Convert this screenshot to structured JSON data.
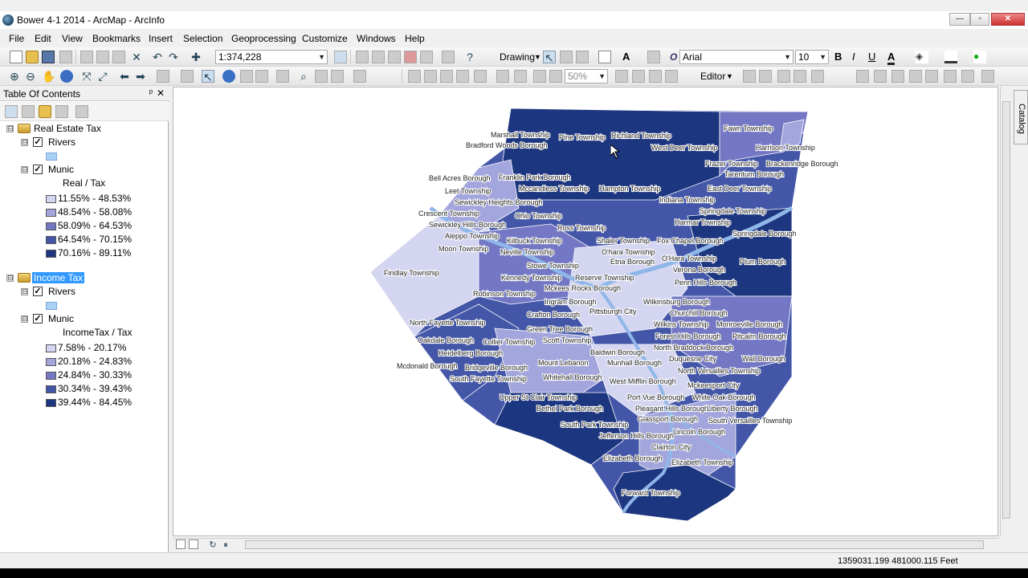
{
  "window": {
    "title": "Bower 4-1 2014 - ArcMap - ArcInfo",
    "min_glyph": "—",
    "max_glyph": "▫",
    "close_glyph": "✕"
  },
  "menu": [
    "File",
    "Edit",
    "View",
    "Bookmarks",
    "Insert",
    "Selection",
    "Geoprocessing",
    "Customize",
    "Windows",
    "Help"
  ],
  "toolbar": {
    "scale_value": "1:374,228",
    "drawing_label": "Drawing",
    "font_name": "Arial",
    "font_size": "10",
    "bold": "B",
    "italic": "I",
    "underline": "U",
    "text_tool": "A",
    "zoom_percent": "50%",
    "editor_label": "Editor"
  },
  "toc": {
    "title": "Table Of Contents",
    "pin_glyph": "ᵖ",
    "close_glyph": "✕",
    "expander_glyph": "⊟",
    "check_glyph": "✓",
    "groups": [
      {
        "name": "Real Estate Tax",
        "rivers_label": "Rivers",
        "munic_label": "Munic",
        "field_label": "Real / Tax",
        "classes": [
          {
            "label": "11.55% - 48.53%",
            "color": "#d4d5f0"
          },
          {
            "label": "48.54% - 58.08%",
            "color": "#a3a6dc"
          },
          {
            "label": "58.09% - 64.53%",
            "color": "#7478c4"
          },
          {
            "label": "64.54% - 70.15%",
            "color": "#4356a8"
          },
          {
            "label": "70.16% - 89.11%",
            "color": "#1d3680"
          }
        ]
      },
      {
        "name": "Income Tax",
        "rivers_label": "Rivers",
        "munic_label": "Munic",
        "field_label": "IncomeTax / Tax",
        "classes": [
          {
            "label": "7.58% - 20.17%",
            "color": "#d4d5f0"
          },
          {
            "label": "20.18% - 24.83%",
            "color": "#a3a6dc"
          },
          {
            "label": "24.84% - 30.33%",
            "color": "#7478c4"
          },
          {
            "label": "30.34% - 39.43%",
            "color": "#4356a8"
          },
          {
            "label": "39.44% - 84.45%",
            "color": "#1d3680"
          }
        ]
      }
    ]
  },
  "map": {
    "river_color": "#8fb6e8",
    "labels": [
      "Marshall Township",
      "Pine Township",
      "Richland Township",
      "Fawn Township",
      "Bradford Woods Borough",
      "West Deer Township",
      "Harrison Township",
      "Frazer Township",
      "Brackenridge Borough",
      "Tarentum Borough",
      "Bell Acres Borough",
      "Franklin Park Borough",
      "Leet Township",
      "Mccandless Township",
      "Hampton Township",
      "East Deer Township",
      "Sewickley Heights Borough",
      "Indiana Township",
      "Springdale Township",
      "Crescent Township",
      "Ohio Township",
      "Harmar Township",
      "Sewickley Hills Borough",
      "Ross Township",
      "Springdale Borough",
      "Aleppo Township",
      "Kilbuck Township",
      "Shaler Township",
      "Fox Chapel Borough",
      "Moon Township",
      "Neville Township",
      "O'hara Township",
      "O'Hara Township",
      "Plum Borough",
      "Etna Borough",
      "Verona Borough",
      "Stowe Township",
      "Findlay Township",
      "Kennedy Township",
      "Reserve Township",
      "Penn Hills Borough",
      "Mckees Rocks Borough",
      "Robinson Township",
      "Ingram Borough",
      "Wilkinsburg Borough",
      "Pittsburgh City",
      "Crafton Borough",
      "Churchill Borough",
      "North Fayette Township",
      "Wilkins Township",
      "Monroeville Borough",
      "Green Tree Borough",
      "Forest Hills Borough",
      "Pitcairn Borough",
      "Oakdale Borough",
      "Collier Township",
      "Scott Township",
      "North Braddock Borough",
      "Heidelberg Borough",
      "Baldwin Borough",
      "Duquesne City",
      "Wall Borough",
      "Mount Lebanon",
      "Munhall Borough",
      "Mcdonald Borough",
      "Bridgeville Borough",
      "North Versailles Township",
      "South Fayette Township",
      "Whitehall Borough",
      "West Mifflin Borough",
      "Mckeesport City",
      "Upper St Clair Township",
      "Port Vue Borough",
      "White Oak Borough",
      "Bethel Park Borough",
      "Pleasant Hills Borough",
      "Liberty Borough",
      "Glassport Borough",
      "South Park Township",
      "South Versailles Township",
      "Lincoln Borough",
      "Jefferson Hills Borough",
      "Clairton City",
      "Elizabeth Borough",
      "Elizabeth Township",
      "Forward Township"
    ]
  },
  "status": {
    "coordinates": "1359031.199  481000.115 Feet"
  },
  "catalog_label": "Catalog"
}
